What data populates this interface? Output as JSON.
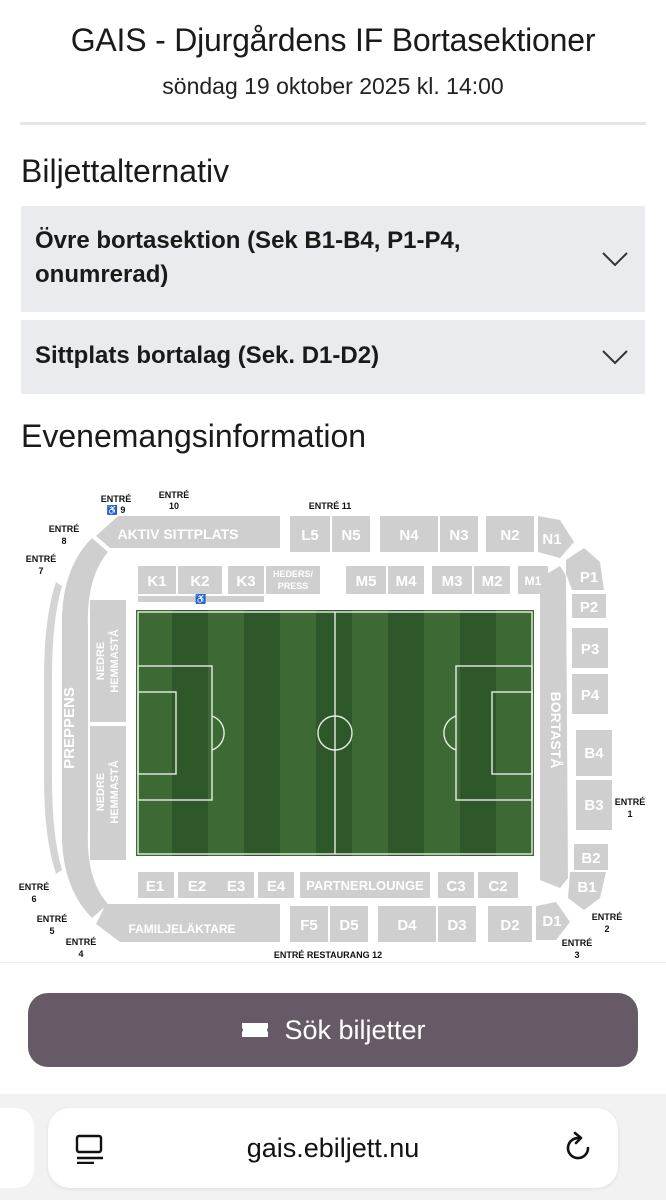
{
  "event": {
    "title": "GAIS - Djurgårdens IF Bortasektioner",
    "date": "söndag 19 oktober 2025 kl. 14:00"
  },
  "ticket_options": {
    "heading": "Biljettalternativ",
    "items": [
      {
        "label_line1": "Övre bortasektion (Sek B1-B4, P1-P4,",
        "label_line2": "onumrerad)"
      },
      {
        "label_line1": "Sittplats bortalag (Sek. D1-D2)"
      }
    ]
  },
  "event_info": {
    "heading": "Evenemangsinformation"
  },
  "stadium_map": {
    "stand_names": {
      "aktiv": "AKTIV SITTPLATS",
      "preppens": "PREPPENS",
      "nedre_hemmasta_1": "NEDRE HEMMASTÅ",
      "nedre_hemmasta_2": "NEDRE HEMMASTÅ",
      "bortasta": "BORTASTÅ",
      "familj": "FAMILJELÄKTARE",
      "partner": "PARTNERLOUNGE",
      "heders_1": "HEDERS/",
      "heders_2": "PRESS"
    },
    "sections": {
      "L5": "L5",
      "N5": "N5",
      "N4": "N4",
      "N3": "N3",
      "N2": "N2",
      "N1": "N1",
      "K1": "K1",
      "K2": "K2",
      "K3": "K3",
      "M5": "M5",
      "M4": "M4",
      "M3": "M3",
      "M2": "M2",
      "M1": "M1",
      "P1": "P1",
      "P2": "P2",
      "P3": "P3",
      "P4": "P4",
      "B4": "B4",
      "B3": "B3",
      "B2": "B2",
      "B1": "B1",
      "E1": "E1",
      "E2": "E2",
      "E3": "E3",
      "E4": "E4",
      "C3": "C3",
      "C2": "C2",
      "F5": "F5",
      "D5": "D5",
      "D4": "D4",
      "D3": "D3",
      "D2": "D2",
      "D1": "D1"
    },
    "entrances": {
      "e10_a": "ENTRÉ",
      "e10_b": "10",
      "e9_a": "ENTRÉ",
      "e9_b": "♿ 9",
      "e8_a": "ENTRÉ",
      "e8_b": "8",
      "e7_a": "ENTRÉ",
      "e7_b": "7",
      "e11": "ENTRÉ 11",
      "e1_a": "ENTRÉ",
      "e1_b": "1",
      "e2_a": "ENTRÉ",
      "e2_b": "2",
      "e3_a": "ENTRÉ",
      "e3_b": "3",
      "e4_a": "ENTRÉ",
      "e4_b": "4",
      "e5_a": "ENTRÉ",
      "e5_b": "5",
      "e6_a": "ENTRÉ",
      "e6_b": "6",
      "e12": "ENTRÉ RESTAURANG 12"
    },
    "colors": {
      "stand": "#cfcfcf",
      "stand_label": "#ffffff",
      "pitch_dark": "#2f5a2a",
      "pitch_light": "#3e6a35",
      "line": "#e8efe6"
    }
  },
  "actions": {
    "search_label": "Sök biljetter",
    "search_icon": "ticket-icon"
  },
  "browser": {
    "url": "gais.ebiljett.nu",
    "left_icon": "reader-icon",
    "right_icon": "reload-icon"
  }
}
